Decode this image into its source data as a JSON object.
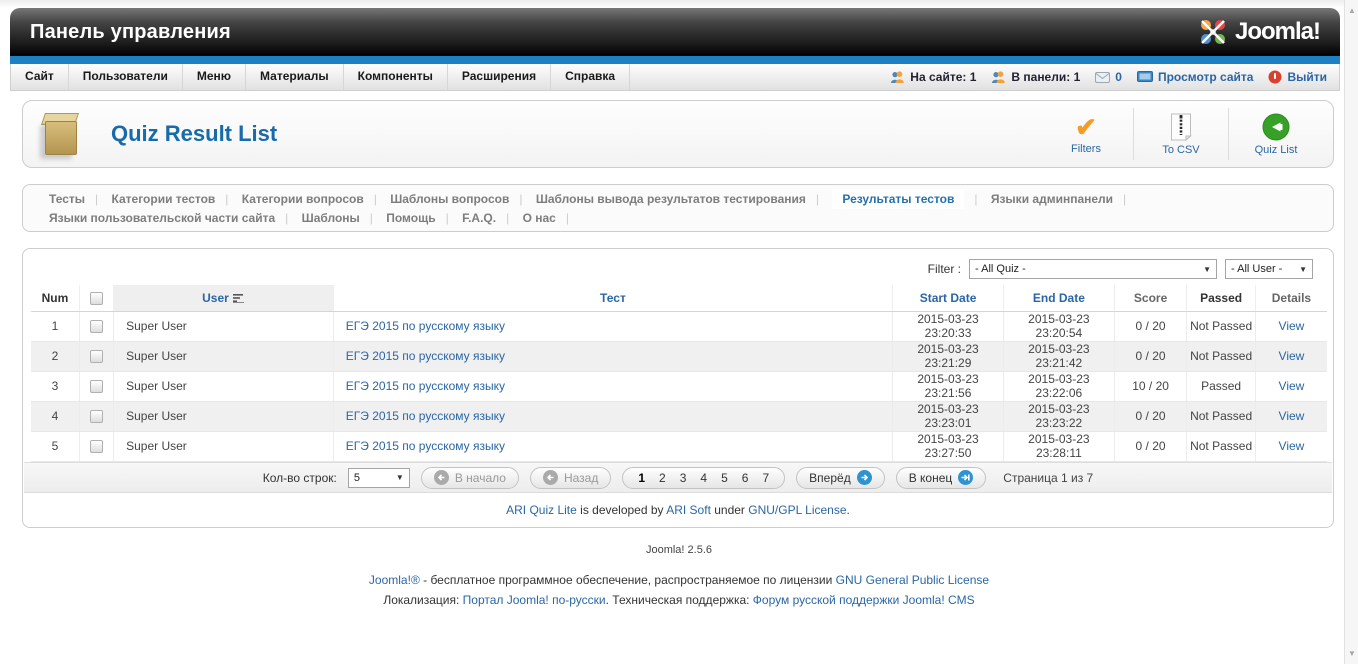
{
  "topbar": {
    "title": "Панель управления",
    "logo": "Joomla!"
  },
  "menubar": {
    "items": [
      "Сайт",
      "Пользователи",
      "Меню",
      "Материалы",
      "Компоненты",
      "Расширения",
      "Справка"
    ],
    "status": {
      "on_site": "На сайте: 1",
      "in_panel": "В панели: 1",
      "messages": "0",
      "view_site": "Просмотр сайта",
      "logout": "Выйти"
    }
  },
  "page": {
    "title": "Quiz Result List",
    "toolbar": {
      "filters": "Filters",
      "to_csv": "To CSV",
      "quiz_list": "Quiz List"
    }
  },
  "submenu": {
    "row1": [
      "Тесты",
      "Категории тестов",
      "Категории вопросов",
      "Шаблоны вопросов",
      "Шаблоны вывода результатов тестирования",
      "Результаты тестов",
      "Языки админпанели"
    ],
    "row2": [
      "Языки пользовательской части сайта",
      "Шаблоны",
      "Помощь",
      "F.A.Q.",
      "О нас"
    ],
    "active": "Результаты тестов"
  },
  "filter": {
    "label": "Filter :",
    "quiz": "- All Quiz -",
    "user": "- All User -"
  },
  "table": {
    "headers": {
      "num": "Num",
      "user": "User",
      "test": "Тест",
      "start": "Start Date",
      "end": "End Date",
      "score": "Score",
      "passed": "Passed",
      "details": "Details"
    },
    "rows": [
      {
        "num": "1",
        "user": "Super User",
        "test": "ЕГЭ 2015 по русскому языку",
        "start": "2015-03-23 23:20:33",
        "end": "2015-03-23 23:20:54",
        "score": "0 / 20",
        "passed": "Not Passed",
        "details": "View"
      },
      {
        "num": "2",
        "user": "Super User",
        "test": "ЕГЭ 2015 по русскому языку",
        "start": "2015-03-23 23:21:29",
        "end": "2015-03-23 23:21:42",
        "score": "0 / 20",
        "passed": "Not Passed",
        "details": "View"
      },
      {
        "num": "3",
        "user": "Super User",
        "test": "ЕГЭ 2015 по русскому языку",
        "start": "2015-03-23 23:21:56",
        "end": "2015-03-23 23:22:06",
        "score": "10 / 20",
        "passed": "Passed",
        "details": "View"
      },
      {
        "num": "4",
        "user": "Super User",
        "test": "ЕГЭ 2015 по русскому языку",
        "start": "2015-03-23 23:23:01",
        "end": "2015-03-23 23:23:22",
        "score": "0 / 20",
        "passed": "Not Passed",
        "details": "View"
      },
      {
        "num": "5",
        "user": "Super User",
        "test": "ЕГЭ 2015 по русскому языку",
        "start": "2015-03-23 23:27:50",
        "end": "2015-03-23 23:28:11",
        "score": "0 / 20",
        "passed": "Not Passed",
        "details": "View"
      }
    ]
  },
  "pagination": {
    "rows_label": "Кол-во строк:",
    "rows_value": "5",
    "first": "В начало",
    "prev": "Назад",
    "pages": [
      "1",
      "2",
      "3",
      "4",
      "5",
      "6",
      "7"
    ],
    "next": "Вперёд",
    "last": "В конец",
    "info": "Страница 1 из 7"
  },
  "ari_footer": {
    "link1": "ARI Quiz Lite",
    "text1": " is developed by ",
    "link2": "ARI Soft",
    "text2": " under ",
    "link3": "GNU/GPL License",
    "text3": "."
  },
  "footer": {
    "version": "Joomla! 2.5.6",
    "line1_link1": "Joomla!®",
    "line1_text1": " - бесплатное программное обеспечение, распространяемое по лицензии ",
    "line1_link2": "GNU General Public License",
    "line2_text1": "Локализация: ",
    "line2_link1": "Портал Joomla! по-русски",
    "line2_text2": ". Техническая поддержка: ",
    "line2_link2": "Форум русской поддержки Joomla! CMS"
  }
}
